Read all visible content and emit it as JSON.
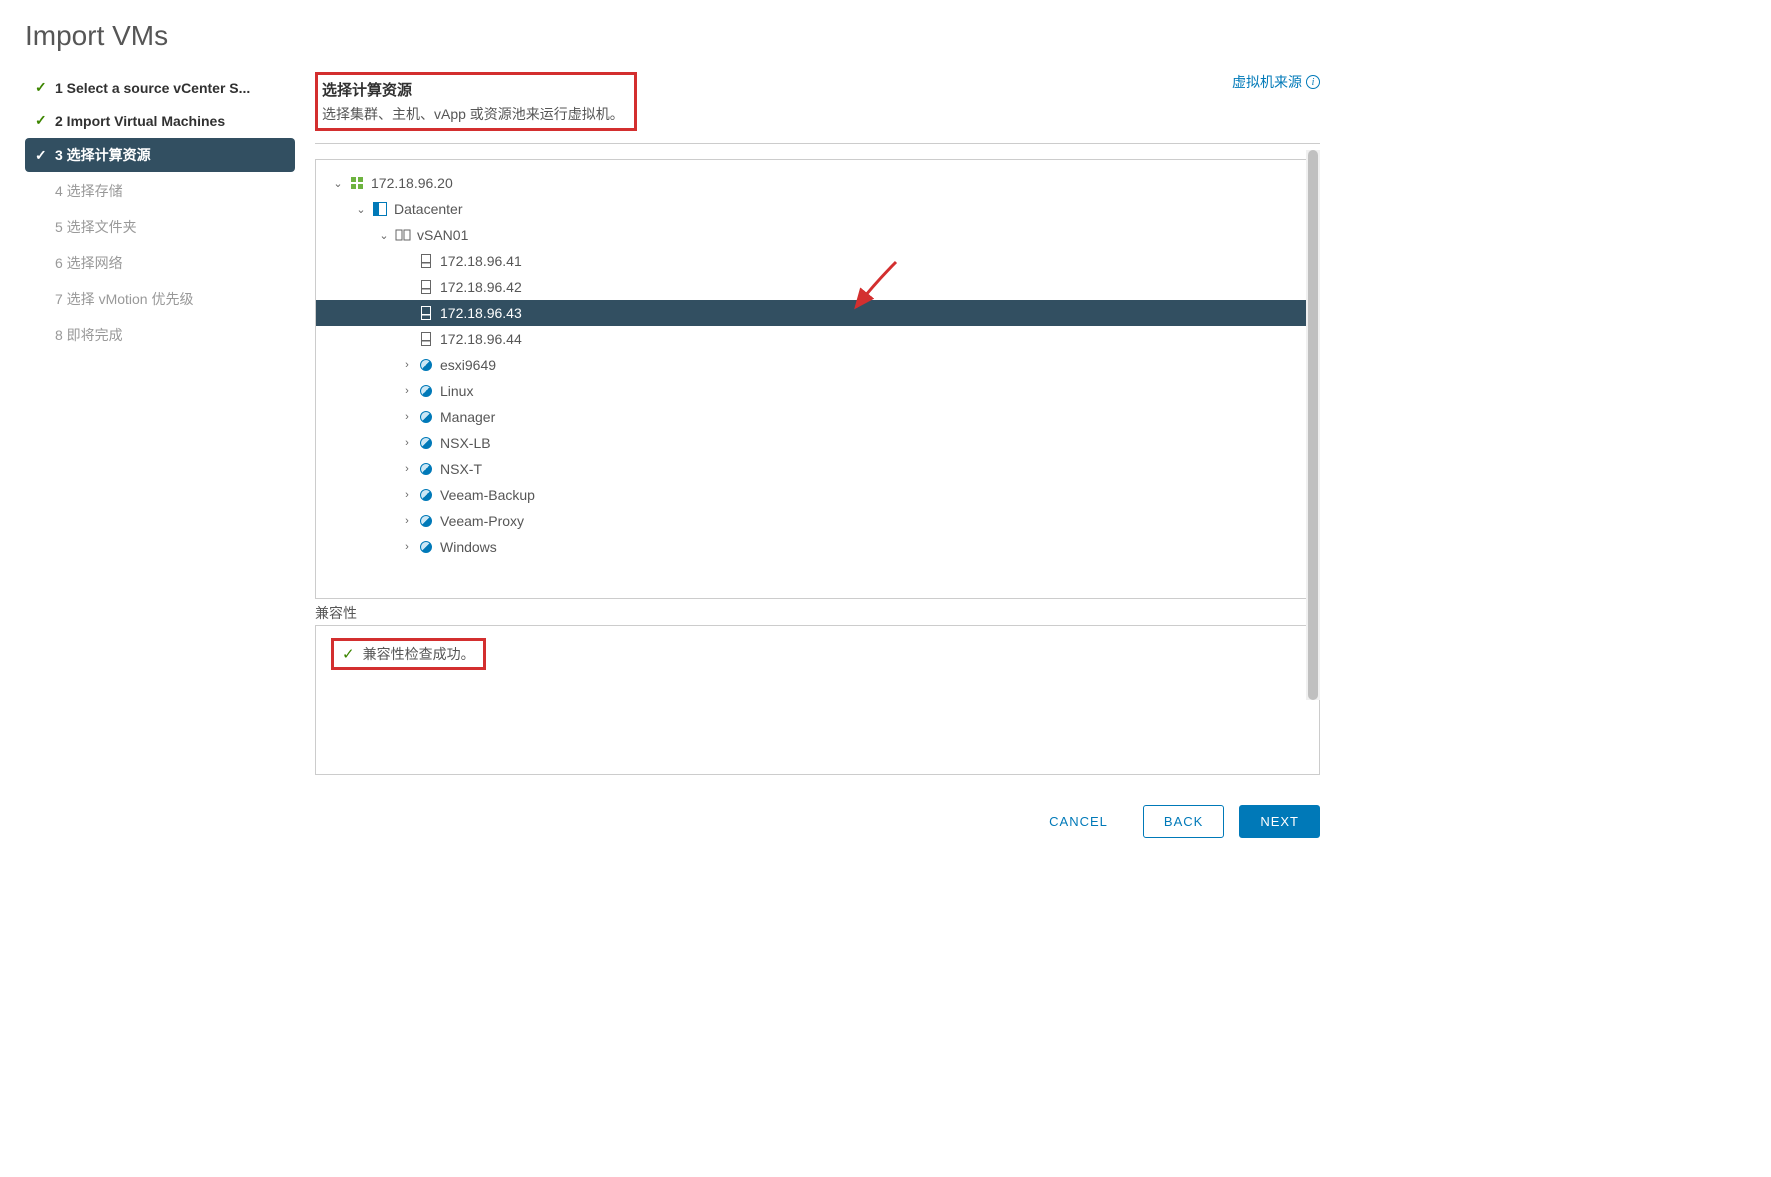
{
  "title": "Import VMs",
  "steps": [
    {
      "label": "1 Select a source vCenter S...",
      "state": "completed"
    },
    {
      "label": "2 Import Virtual Machines",
      "state": "completed"
    },
    {
      "label": "3 选择计算资源",
      "state": "active"
    },
    {
      "label": "4 选择存储",
      "state": "pending"
    },
    {
      "label": "5 选择文件夹",
      "state": "pending"
    },
    {
      "label": "6 选择网络",
      "state": "pending"
    },
    {
      "label": "7 选择 vMotion 优先级",
      "state": "pending"
    },
    {
      "label": "8 即将完成",
      "state": "pending"
    }
  ],
  "header": {
    "title": "选择计算资源",
    "description": "选择集群、主机、vApp 或资源池来运行虚拟机。",
    "link": "虚拟机来源"
  },
  "tree": {
    "root": "172.18.96.20",
    "datacenter": "Datacenter",
    "cluster": "vSAN01",
    "hosts": [
      "172.18.96.41",
      "172.18.96.42",
      "172.18.96.43",
      "172.18.96.44"
    ],
    "selected_host": "172.18.96.43",
    "pools": [
      "esxi9649",
      "Linux",
      "Manager",
      "NSX-LB",
      "NSX-T",
      "Veeam-Backup",
      "Veeam-Proxy",
      "Windows"
    ]
  },
  "compatibility": {
    "label": "兼容性",
    "message": "兼容性检查成功。"
  },
  "buttons": {
    "cancel": "CANCEL",
    "back": "BACK",
    "next": "NEXT"
  }
}
